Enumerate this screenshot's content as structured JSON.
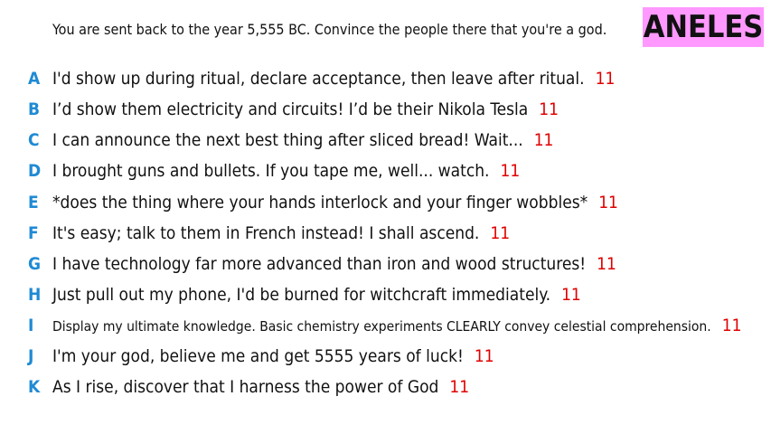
{
  "prompt": "You are sent back to the year 5,555 BC. Convince the people there that you're a god.",
  "badge": "ANELES",
  "colors": {
    "letter": "#1f8ad4",
    "score": "#e00000",
    "badge_bg": "#ff99ff"
  },
  "answers": [
    {
      "letter": "A",
      "text": "I'd show up during ritual, declare acceptance, then leave after ritual.",
      "score": "11"
    },
    {
      "letter": "B",
      "text": "I’d show them electricity and circuits! I’d be their Nikola Tesla",
      "score": "11"
    },
    {
      "letter": "C",
      "text": "I can announce the next best thing after sliced bread! Wait...",
      "score": "11"
    },
    {
      "letter": "D",
      "text": "I brought guns and bullets. If you tape me, well... watch.",
      "score": "11"
    },
    {
      "letter": "E",
      "text": "*does the thing where your hands interlock and your finger wobbles*",
      "score": "11"
    },
    {
      "letter": "F",
      "text": "It's easy; talk to them in French instead! I shall ascend.",
      "score": "11"
    },
    {
      "letter": "G",
      "text": "I have technology far more advanced than iron and wood structures!",
      "score": "11"
    },
    {
      "letter": "H",
      "text": "Just pull out my phone, I'd be burned for witchcraft immediately.",
      "score": "11"
    },
    {
      "letter": "I",
      "text": "Display my ultimate knowledge. Basic chemistry experiments CLEARLY convey celestial comprehension.",
      "score": "11"
    },
    {
      "letter": "J",
      "text": "I'm your god, believe me and get 5555 years of luck!",
      "score": "11"
    },
    {
      "letter": "K",
      "text": "As I rise, discover that I harness the power of God",
      "score": "11"
    }
  ]
}
